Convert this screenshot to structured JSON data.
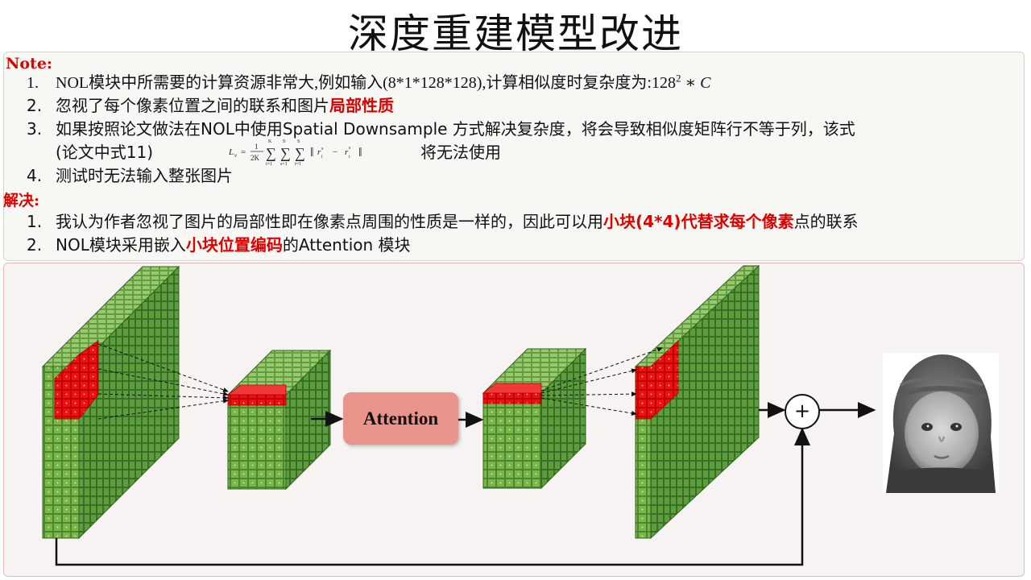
{
  "title": "深度重建模型改进",
  "note": {
    "label": "Note:",
    "items": [
      {
        "num": "1.",
        "text_a": "NOL模块中所需要的计算资源非常大,例如输入(8*1*128*128),计算相似度时复杂度为:128",
        "sup": "2",
        "text_b": " ∗ C"
      },
      {
        "num": "2.",
        "text": "忽视了每个像素位置之间的联系和图片",
        "highlight": "局部性质"
      },
      {
        "num": "3.",
        "text": "如果按照论文做法在NOL中使用Spatial Downsample 方式解决复杂度，将会导致相似度矩阵行不等于列，该式",
        "text2": "(论文中式11)",
        "text3": "将无法使用"
      },
      {
        "num": "4.",
        "text": "测试时无法输入整张图片"
      }
    ],
    "formula": "L_v = 1/(2K) Σ_{i=1}^{K} Σ_{s=1}^{S_h} Σ_{t=1}^{S_h} ‖ r_i^{s_t} − r_i^{s_t^T} ‖"
  },
  "solution": {
    "label": "解决:",
    "items": [
      {
        "num": "1.",
        "text_a": "我认为作者忽视了图片的局部性即在像素点周围的性质是一样的，因此可以用",
        "highlight": "小块(4*4)代替求每个像素",
        "text_b": "点的联系"
      },
      {
        "num": "2.",
        "text_a": "NOL模块采用嵌入",
        "highlight": "小块位置编码",
        "text_b": "的Attention 模块"
      }
    ]
  },
  "diagram": {
    "attention_label": "Attention",
    "plus_symbol": "+",
    "colors": {
      "cube_front": "#7ab648",
      "cube_side": "#5a9a3a",
      "cube_top": "#95c76a",
      "patch": "#ee1111",
      "attention": "#e8948a"
    }
  }
}
